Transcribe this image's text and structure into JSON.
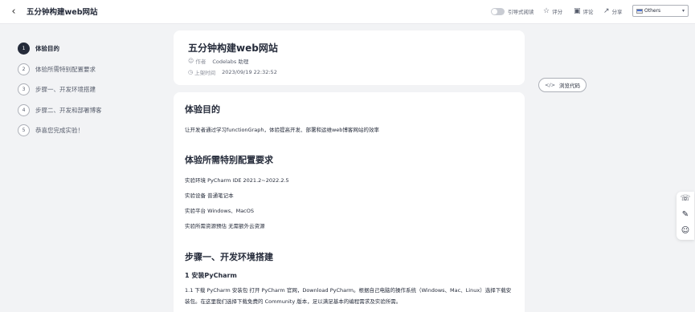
{
  "header": {
    "back_icon": "chevron-left-icon",
    "title": "五分钟构建web网站",
    "guided_reading": "引导式阅读",
    "rating": "评分",
    "comments": "评论",
    "share": "分享",
    "language": "Others"
  },
  "toc": {
    "items": [
      {
        "num": "1",
        "label": "体验目的",
        "active": true
      },
      {
        "num": "2",
        "label": "体验所需特别配置要求"
      },
      {
        "num": "3",
        "label": "步骤一、开发环境搭建"
      },
      {
        "num": "4",
        "label": "步骤二、开发和部署博客"
      },
      {
        "num": "5",
        "label": "恭喜您完成实验！"
      }
    ]
  },
  "article": {
    "title": "五分钟构建web网站",
    "author_label": "作者",
    "author": "Codelabs 助理",
    "time_label": "上架时间",
    "time": "2023/09/19 22:32:52",
    "view_code": "浏览代码"
  },
  "content": {
    "s1_title": "体验目的",
    "s1_p1": "让开发者通过学习functionGraph，体验提高开发、部署和运维web博客网站的效率",
    "s2_title": "体验所需特别配置要求",
    "s2_p1": "实验环境 PyCharm IDE 2021.2~2022.2.5",
    "s2_p2": "实验设备 普通笔记本",
    "s2_p3": "实验平台 Windows、MacOS",
    "s2_p4": "实验所需资源预估 无需额外云资源",
    "s3_title": "步骤一、开发环境搭建",
    "s3_sub": "1 安装PyCharm",
    "s3_p1": "1.1 下载 PyCharm 安装包 打开 PyCharm 官网，Download PyCharm。根据自己电脑的操作系统（Windows、Mac、Linux）选择下载安装包。在这里我们选择下载免费的 Community 版本，足以满足基本的编程需求及实验所需。"
  },
  "side_tools": [
    "headset-icon",
    "pen-icon",
    "smiley-icon"
  ]
}
